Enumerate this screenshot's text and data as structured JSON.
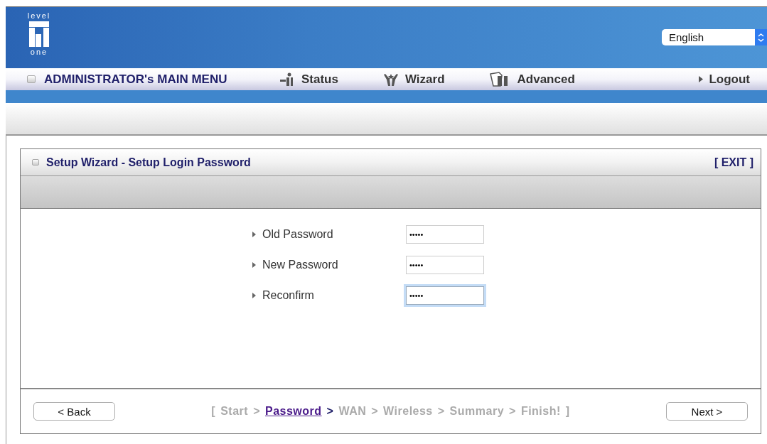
{
  "header": {
    "logo_top": "level",
    "logo_bottom": "one",
    "language": "English"
  },
  "menu": {
    "title": "ADMINISTRATOR's MAIN MENU",
    "items": [
      {
        "label": "Status",
        "kind": "status"
      },
      {
        "label": "Wizard",
        "kind": "wizard"
      },
      {
        "label": "Advanced",
        "kind": "advanced"
      }
    ],
    "logout": "Logout"
  },
  "panel": {
    "title": "Setup Wizard - Setup Login Password",
    "exit": "[ EXIT ]",
    "fields": [
      {
        "label": "Old Password",
        "value": "•••••",
        "focused": false
      },
      {
        "label": "New Password",
        "value": "•••••",
        "focused": false
      },
      {
        "label": "Reconfirm",
        "value": "•••••",
        "focused": true
      }
    ]
  },
  "footer": {
    "back": "< Back",
    "next": "Next >",
    "open": "[",
    "close": "]",
    "separator": ">",
    "steps": [
      {
        "label": "Start",
        "selected": false
      },
      {
        "label": "Password",
        "selected": true
      },
      {
        "label": "WAN",
        "selected": false
      },
      {
        "label": "Wireless",
        "selected": false
      },
      {
        "label": "Summary",
        "selected": false
      },
      {
        "label": "Finish!",
        "selected": false
      }
    ]
  }
}
